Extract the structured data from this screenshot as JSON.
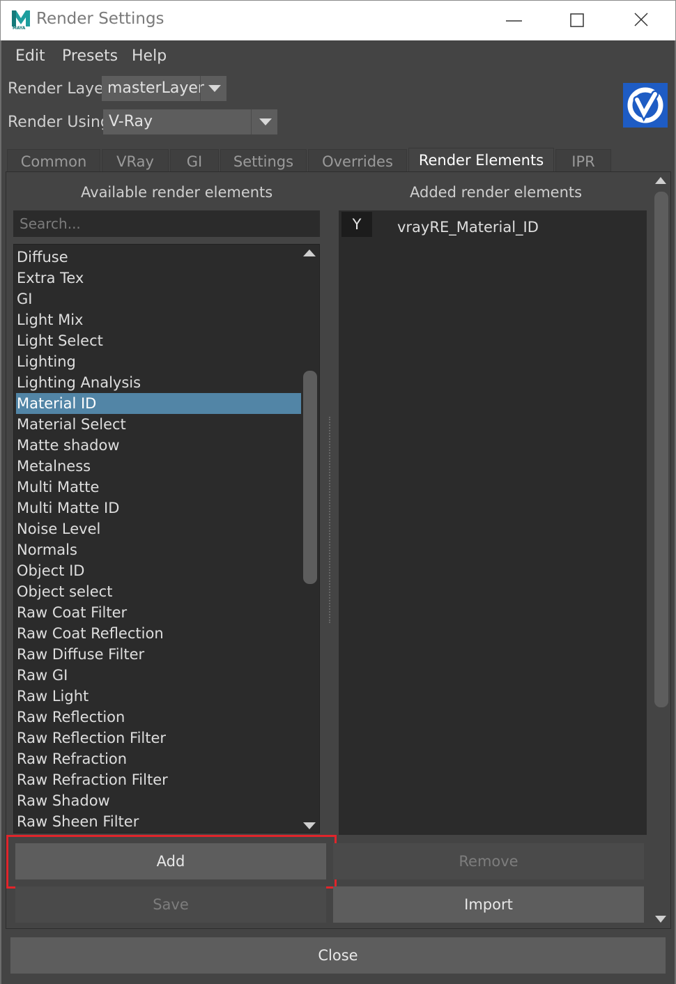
{
  "window": {
    "title": "Render Settings",
    "app_logo_letter": "M",
    "app_logo_sub": "MAYA",
    "app_logo_color": "#1d9e9e"
  },
  "menu": [
    "Edit",
    "Presets",
    "Help"
  ],
  "render_layer": {
    "label": "Render Layer",
    "value": "masterLayer"
  },
  "render_using": {
    "label": "Render Using",
    "value": "V-Ray"
  },
  "vray_badge_color": "#1e5cc4",
  "tabs": [
    {
      "label": "Common",
      "active": false
    },
    {
      "label": "VRay",
      "active": false
    },
    {
      "label": "GI",
      "active": false
    },
    {
      "label": "Settings",
      "active": false
    },
    {
      "label": "Overrides",
      "active": false
    },
    {
      "label": "Render Elements",
      "active": true
    },
    {
      "label": "IPR",
      "active": false
    }
  ],
  "available": {
    "heading": "Available render elements",
    "search_placeholder": "Search...",
    "selected": "Material ID",
    "items": [
      "Diffuse",
      "Extra Tex",
      "GI",
      "Light Mix",
      "Light Select",
      "Lighting",
      "Lighting Analysis",
      "Material ID",
      "Material Select",
      "Matte shadow",
      "Metalness",
      "Multi Matte",
      "Multi Matte ID",
      "Noise Level",
      "Normals",
      "Object ID",
      "Object select",
      "Raw Coat Filter",
      "Raw Coat Reflection",
      "Raw Diffuse Filter",
      "Raw GI",
      "Raw Light",
      "Raw Reflection",
      "Raw Reflection Filter",
      "Raw Refraction",
      "Raw Refraction Filter",
      "Raw Shadow",
      "Raw Sheen Filter"
    ]
  },
  "added": {
    "heading": "Added render elements",
    "items": [
      {
        "flag": "Y",
        "name": "vrayRE_Material_ID"
      }
    ]
  },
  "buttons": {
    "add": "Add",
    "remove": "Remove",
    "save": "Save",
    "import": "Import",
    "close": "Close"
  },
  "colors": {
    "selection": "#5285a6",
    "highlight_box": "#e0252b"
  }
}
